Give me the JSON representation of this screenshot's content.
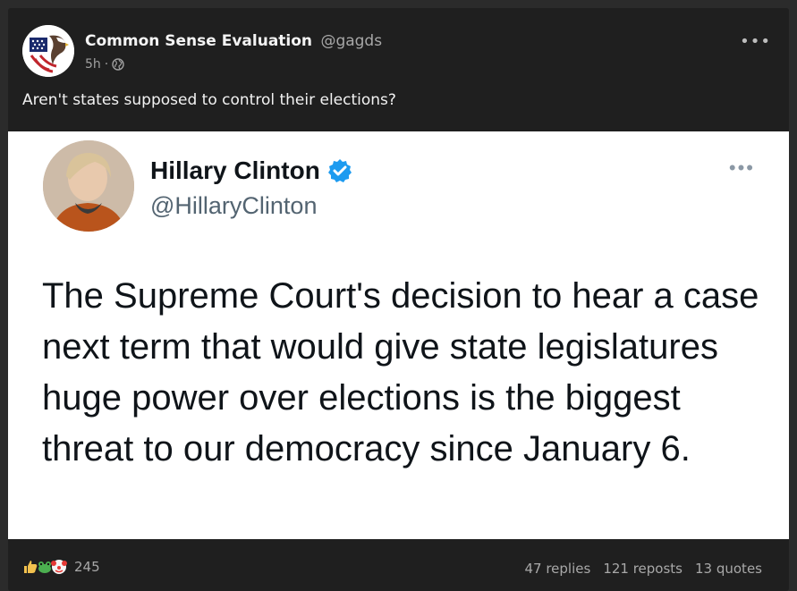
{
  "post": {
    "author_name": "Common Sense Evaluation",
    "author_handle": "@gagds",
    "time": "5h",
    "separator": "·",
    "more": "•••",
    "text": "Aren't states supposed to control their elections?"
  },
  "tweet": {
    "name": "Hillary Clinton",
    "handle": "@HillaryClinton",
    "more": "•••",
    "body": "The Supreme Court's decision to hear a case next term that would give state legislatures huge power over elections is the biggest threat to our democracy since January 6."
  },
  "footer": {
    "reaction_count": "245",
    "reaction_icons": [
      "thumbs-up-icon",
      "frog-icon",
      "clown-icon"
    ],
    "replies": "47 replies",
    "reposts": "121 reposts",
    "quotes": "13 quotes"
  },
  "colors": {
    "card_bg": "#1f1f1f",
    "page_bg": "#2b2b2b",
    "verified_blue": "#1d9bf0",
    "tweet_handle": "#536471"
  }
}
